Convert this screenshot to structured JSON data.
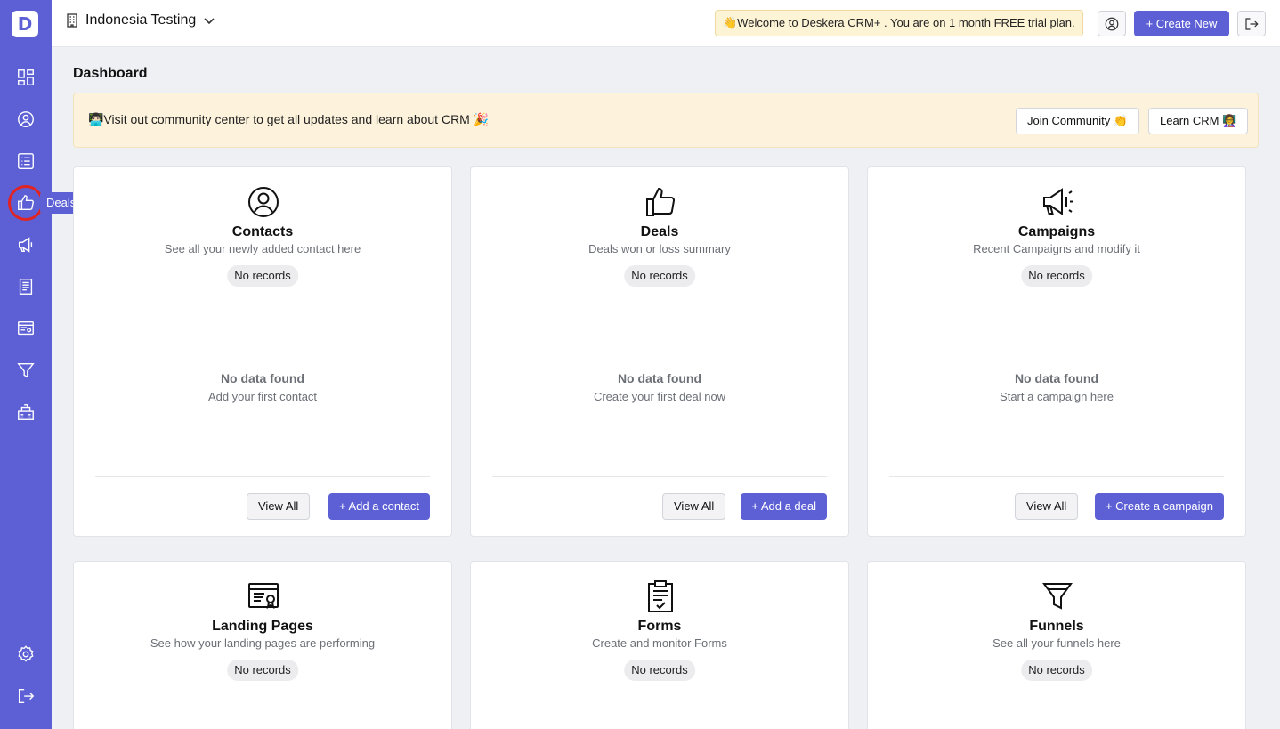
{
  "sidebar": {
    "logo": "D",
    "tooltip": "Deals",
    "items": [
      {
        "name": "dashboard"
      },
      {
        "name": "contacts"
      },
      {
        "name": "list"
      },
      {
        "name": "deals"
      },
      {
        "name": "campaigns"
      },
      {
        "name": "forms"
      },
      {
        "name": "landing-pages"
      },
      {
        "name": "funnels"
      },
      {
        "name": "building"
      },
      {
        "name": "settings"
      },
      {
        "name": "logout"
      }
    ]
  },
  "header": {
    "org_name": "Indonesia Testing",
    "welcome": "👋Welcome to Deskera CRM+ . You are on 1 month FREE trial plan.",
    "create_new": "+ Create New"
  },
  "page": {
    "title": "Dashboard"
  },
  "banner": {
    "text": "👨🏻‍💻Visit out community center to get all updates and learn about CRM 🎉",
    "join": "Join Community 👏",
    "learn": "Learn CRM 👩‍🏫"
  },
  "cards": [
    {
      "title": "Contacts",
      "subtitle": "See all your newly added contact here",
      "badge": "No records",
      "empty_title": "No data found",
      "empty_sub": "Add your first contact",
      "view_all": "View All",
      "action": "+ Add a contact"
    },
    {
      "title": "Deals",
      "subtitle": "Deals won or loss summary",
      "badge": "No records",
      "empty_title": "No data found",
      "empty_sub": "Create your first deal now",
      "view_all": "View All",
      "action": "+ Add a deal"
    },
    {
      "title": "Campaigns",
      "subtitle": "Recent Campaigns and modify it",
      "badge": "No records",
      "empty_title": "No data found",
      "empty_sub": "Start a campaign here",
      "view_all": "View All",
      "action": "+ Create a campaign"
    },
    {
      "title": "Landing Pages",
      "subtitle": "See how your landing pages are performing",
      "badge": "No records"
    },
    {
      "title": "Forms",
      "subtitle": "Create and monitor Forms",
      "badge": "No records"
    },
    {
      "title": "Funnels",
      "subtitle": "See all your funnels here",
      "badge": "No records"
    }
  ],
  "colors": {
    "brand": "#5d60d5",
    "highlight": "#e02424",
    "banner_bg": "#fdf3dc"
  }
}
